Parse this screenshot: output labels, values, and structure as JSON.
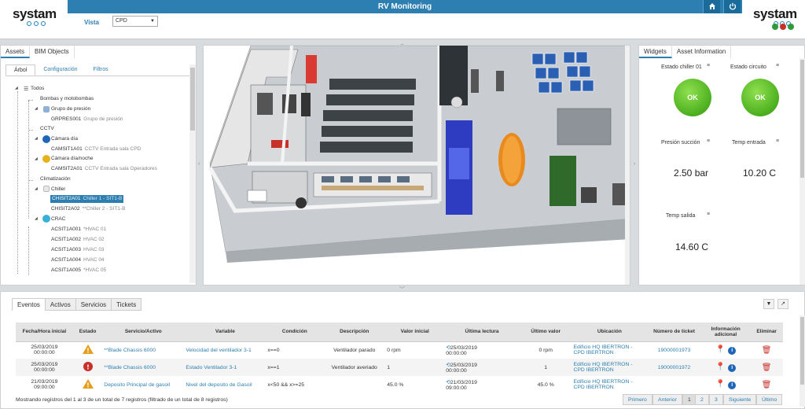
{
  "header": {
    "logo_left": "systam",
    "logo_right": "systam",
    "title": "RV Monitoring",
    "vista_label": "Vista",
    "vista_value": "CPD",
    "home_icon": "home-icon",
    "power_icon": "power-icon",
    "status_colors": [
      "#2f9a3a",
      "#c8302a",
      "#2f9a3a"
    ]
  },
  "left_panel": {
    "tabs": [
      "Assets",
      "BIM Objects"
    ],
    "subtabs": [
      "Árbol",
      "Configuración",
      "Filtros"
    ],
    "tree": [
      {
        "label": "Todos",
        "desc": ""
      },
      {
        "label": "Bombas y motobombas",
        "desc": ""
      },
      {
        "label": "Grupo de presión",
        "desc": ""
      },
      {
        "label": "GRPRES001",
        "desc": "Grupo de presión"
      },
      {
        "label": "CCTV",
        "desc": ""
      },
      {
        "label": "Cámara día",
        "desc": ""
      },
      {
        "label": "CAMSIT1A01",
        "desc": "CCTV Entrada sala CPD"
      },
      {
        "label": "Cámara día/noche",
        "desc": ""
      },
      {
        "label": "CAMSIT2A01",
        "desc": "CCTV Entrada sala Operadores"
      },
      {
        "label": "Climatización",
        "desc": ""
      },
      {
        "label": "Chiller",
        "desc": ""
      },
      {
        "label": "CHISIT2A01",
        "desc": "Chiller 1 - SIT1-B"
      },
      {
        "label": "CHISIT2A02",
        "desc": "**Chiller 2 - SIT1-B"
      },
      {
        "label": "CRAC",
        "desc": ""
      },
      {
        "label": "ACSIT1A001",
        "desc": "*HVAC 01"
      },
      {
        "label": "ACSIT1A002",
        "desc": "HVAC 02"
      },
      {
        "label": "ACSIT1A003",
        "desc": "HVAC 03"
      },
      {
        "label": "ACSIT1A004",
        "desc": "HVAC 04"
      },
      {
        "label": "ACSIT1A005",
        "desc": "*HVAC 05"
      }
    ]
  },
  "right_panel": {
    "tabs": [
      "Widgets",
      "Asset Information"
    ],
    "widgets": [
      {
        "title": "Estado chiller 01",
        "status": "OK"
      },
      {
        "title": "Estado circuito",
        "status": "OK"
      },
      {
        "title": "Presión succión",
        "value": "2.50 bar"
      },
      {
        "title": "Temp entrada",
        "value": "10.20 C"
      },
      {
        "title": "Temp salida",
        "value": "14.60 C"
      }
    ],
    "widget_colors": {
      "ok": "#4caf1f"
    }
  },
  "bottom_panel": {
    "tabs": [
      "Eventos",
      "Activos",
      "Servicios",
      "Tickets"
    ],
    "columns": [
      "Fecha/Hora inicial",
      "Estado",
      "Servicio/Activo",
      "Variable",
      "Condición",
      "Descripción",
      "Valor inicial",
      "Última lectura",
      "Último valor",
      "Ubicación",
      "Número de ticket",
      "Información adicional",
      "Eliminar"
    ],
    "rows": [
      {
        "fecha": "25/03/2019",
        "hora": "00:00:00",
        "estado": "warning",
        "servicio": "**Blade Chassis 6000",
        "variable": "Velocidad del ventilador 3-1",
        "condicion": "x==0",
        "descripcion": "Ventilador parado",
        "valor_inicial": "0 rpm",
        "lectura_fecha": "25/03/2019",
        "lectura_hora": "00:00:00",
        "ultimo_valor": "0 rpm",
        "ubicacion_1": "Edificio HQ IBERTRON -",
        "ubicacion_2": "CPD IBERTRON",
        "ticket": "19000001973"
      },
      {
        "fecha": "25/03/2019",
        "hora": "00:00:00",
        "estado": "error",
        "servicio": "**Blade Chassis 6000",
        "variable": "Estado Ventilador 3-1",
        "condicion": "x==1",
        "descripcion": "Ventilador averiado",
        "valor_inicial": "1",
        "lectura_fecha": "25/03/2019",
        "lectura_hora": "00:00:00",
        "ultimo_valor": "1",
        "ubicacion_1": "Edificio HQ IBERTRON -",
        "ubicacion_2": "CPD IBERTRON",
        "ticket": "19000001972"
      },
      {
        "fecha": "21/03/2019",
        "hora": "09:00:00",
        "estado": "warning",
        "servicio": "Deposito Principal de gasoil",
        "variable": "Nivel del deposito de Gasoil",
        "condicion": "x<50 && x>=25",
        "descripcion": "",
        "valor_inicial": "45.0 %",
        "lectura_fecha": "21/03/2019",
        "lectura_hora": "09:00:00",
        "ultimo_valor": "45.0 %",
        "ubicacion_1": "Edificio HQ IBERTRON -",
        "ubicacion_2": "CPD IBERTRON",
        "ticket": ""
      }
    ],
    "footer_text": "Mostrando registros del 1 al 3 de un total de 7 registros (filtrado de un total de 8 registros)",
    "pagination": [
      "Primero",
      "Anterior",
      "1",
      "2",
      "3",
      "Siguiente",
      "Último"
    ],
    "status_colors": {
      "warning": "#e59d1c",
      "error": "#c8302a",
      "pin": "#b3261e",
      "info": "#1f66b8",
      "trash": "#c8302a"
    }
  }
}
